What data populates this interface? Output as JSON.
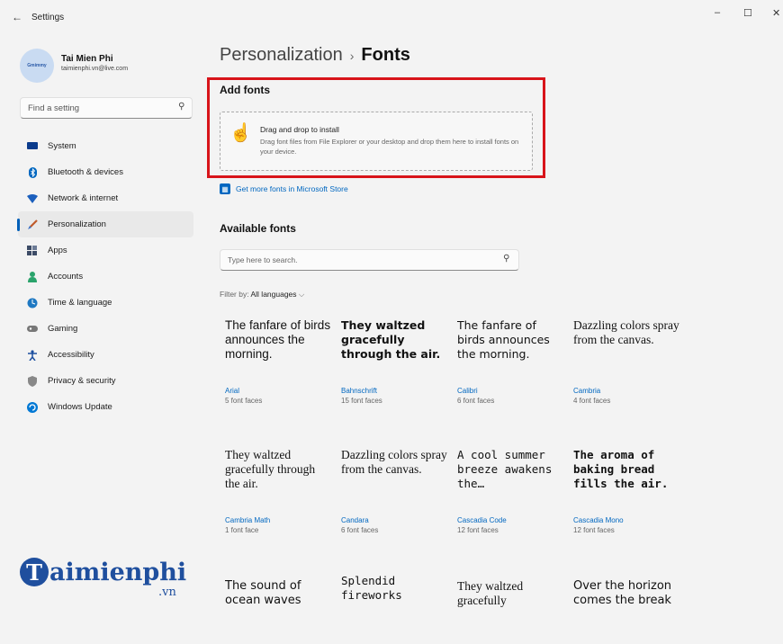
{
  "window": {
    "title": "Settings",
    "back_icon": "←",
    "minimize": "–",
    "maximize": "☐",
    "close": "✕"
  },
  "profile": {
    "name": "Tai Mien Phi",
    "email": "taimienphi.vn@live.com",
    "avatar_text": "Gmimmy"
  },
  "sidebar": {
    "search_placeholder": "Find a setting",
    "items": [
      {
        "label": "System",
        "icon": "system-icon",
        "color": "#0a3b8c"
      },
      {
        "label": "Bluetooth & devices",
        "icon": "bluetooth-icon",
        "color": "#0067c0"
      },
      {
        "label": "Network & internet",
        "icon": "network-icon",
        "color": "#1b5fbd"
      },
      {
        "label": "Personalization",
        "icon": "brush-icon",
        "color": "#c05a2a"
      },
      {
        "label": "Apps",
        "icon": "apps-icon",
        "color": "#3c4b66"
      },
      {
        "label": "Accounts",
        "icon": "accounts-icon",
        "color": "#2aa36b"
      },
      {
        "label": "Time & language",
        "icon": "time-language-icon",
        "color": "#1e78c2"
      },
      {
        "label": "Gaming",
        "icon": "gaming-icon",
        "color": "#777777"
      },
      {
        "label": "Accessibility",
        "icon": "accessibility-icon",
        "color": "#1c4fa0"
      },
      {
        "label": "Privacy & security",
        "icon": "shield-icon",
        "color": "#777777"
      },
      {
        "label": "Windows Update",
        "icon": "update-icon",
        "color": "#0078d4"
      }
    ]
  },
  "logo": {
    "letter": "T",
    "rest": "aimienphi",
    "suffix": ".vn"
  },
  "main": {
    "breadcrumb_parent": "Personalization",
    "breadcrumb_sep": "›",
    "breadcrumb_current": "Fonts",
    "add_fonts_heading": "Add fonts",
    "drop_title": "Drag and drop to install",
    "drop_desc": "Drag font files from File Explorer or your desktop and drop them here to install fonts on your device.",
    "store_link": "Get more fonts in Microsoft Store",
    "available_heading": "Available fonts",
    "font_search_placeholder": "Type here to search.",
    "filter_label": "Filter by:",
    "filter_value": "All languages",
    "fonts": [
      {
        "sample": "The fanfare of birds announces the morning.",
        "name": "Arial",
        "faces": "5 font faces",
        "family": "Liberation Sans"
      },
      {
        "sample": "They waltzed gracefully through the air.",
        "name": "Bahnschrift",
        "faces": "15 font faces",
        "family": "DejaVu Sans"
      },
      {
        "sample": "The fanfare of birds announces the morning.",
        "name": "Calibri",
        "faces": "6 font faces",
        "family": "DejaVu Sans"
      },
      {
        "sample": "Dazzling colors spray from the canvas.",
        "name": "Cambria",
        "faces": "4 font faces",
        "family": "Liberation Serif"
      },
      {
        "sample": "They waltzed gracefully through the air.",
        "name": "Cambria Math",
        "faces": "1 font face",
        "family": "Liberation Serif"
      },
      {
        "sample": "Dazzling colors spray from the canvas.",
        "name": "Candara",
        "faces": "6 font faces",
        "family": "DejaVu Sans"
      },
      {
        "sample": "A cool summer breeze awakens the…",
        "name": "Cascadia Code",
        "faces": "12 font faces",
        "family": "DejaVu Sans Mono"
      },
      {
        "sample": "The aroma of baking bread fills the air.",
        "name": "Cascadia Mono",
        "faces": "12 font faces",
        "family": "DejaVu Sans Mono"
      },
      {
        "sample": "The sound of ocean waves",
        "name": "",
        "faces": "",
        "family": "DejaVu Sans"
      },
      {
        "sample": "Splendid fireworks",
        "name": "",
        "faces": "",
        "family": "DejaVu Sans Mono"
      },
      {
        "sample": "They waltzed gracefully",
        "name": "",
        "faces": "",
        "family": "Liberation Serif"
      },
      {
        "sample": "Over the horizon comes the break",
        "name": "",
        "faces": "",
        "family": "DejaVu Sans"
      }
    ]
  }
}
